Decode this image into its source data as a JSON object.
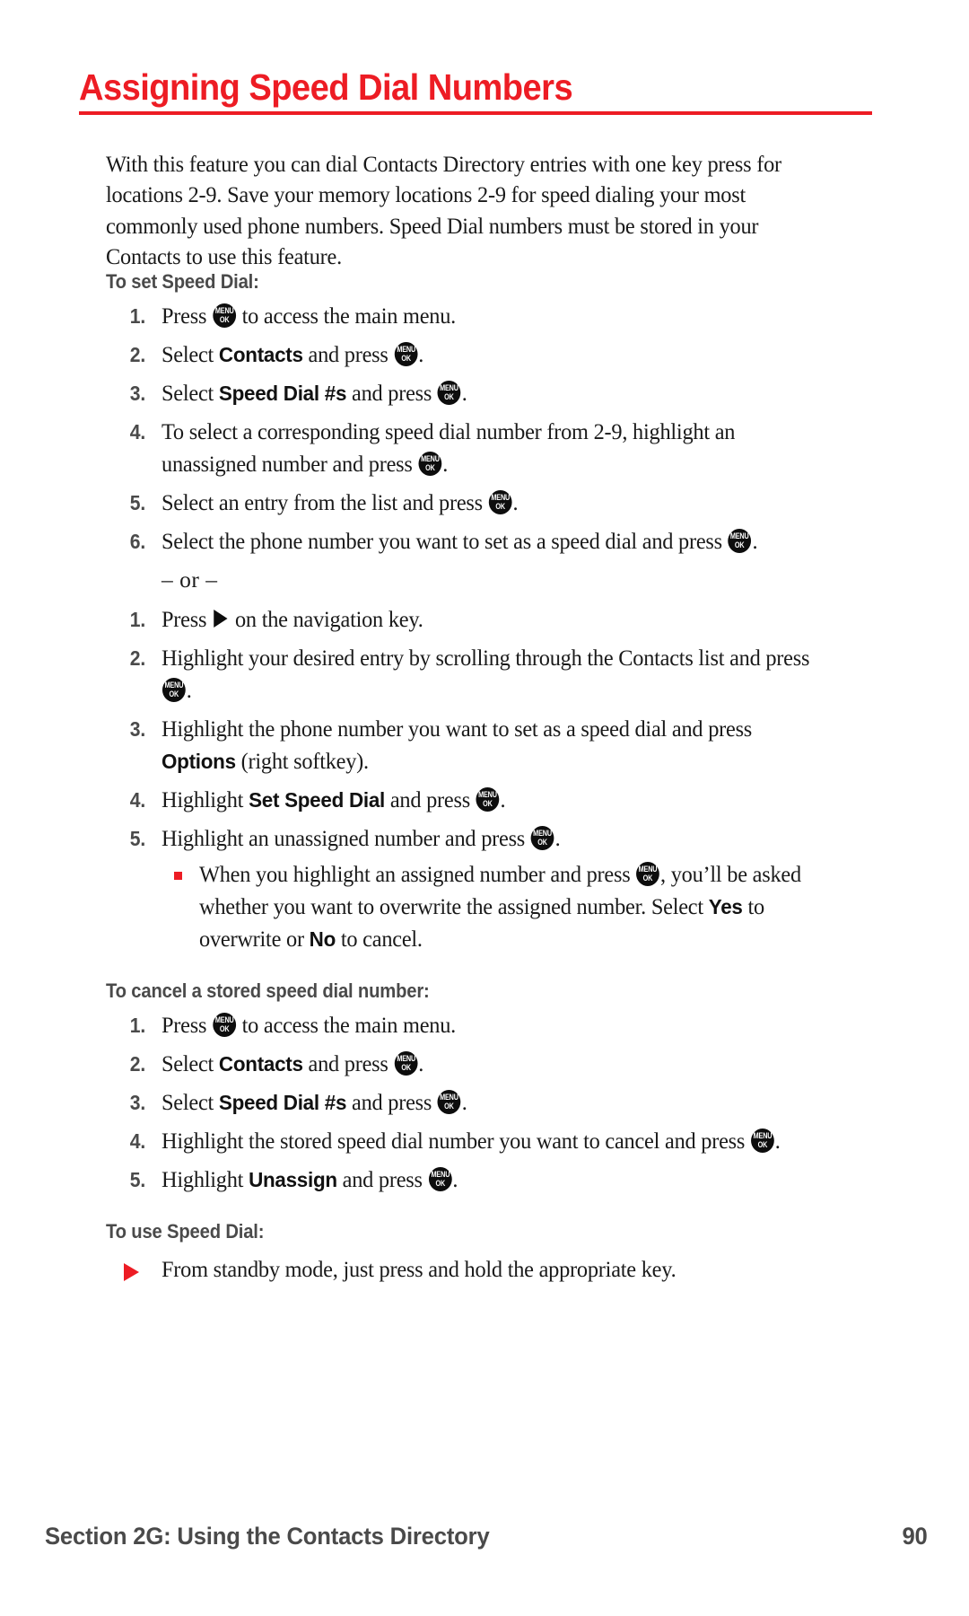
{
  "title": "Assigning Speed Dial Numbers",
  "accent_color": "#ED1C24",
  "heading_color": "#4a4a4a",
  "intro": "With this feature you can dial Contacts Directory entries with one key press for locations 2-9. Save your memory locations 2-9 for speed dialing your most commonly used phone numbers. Speed Dial numbers must be stored in your Contacts to use this feature.",
  "sections": {
    "set": {
      "heading": "To set Speed Dial:",
      "steps": [
        {
          "num": "1.",
          "pre": "Press ",
          "icon": "menu-ok-key",
          "post": " to access the main menu."
        },
        {
          "num": "2.",
          "pre": "Select ",
          "bold": "Contacts",
          "mid": " and press ",
          "icon": "menu-ok-key",
          "post": "."
        },
        {
          "num": "3.",
          "pre": "Select ",
          "bold": "Speed Dial #s",
          "mid": " and press ",
          "icon": "menu-ok-key",
          "post": "."
        },
        {
          "num": "4.",
          "pre": "To select a corresponding speed dial number from 2-9, highlight an unassigned number and press ",
          "icon": "menu-ok-key",
          "post": "."
        },
        {
          "num": "5.",
          "pre": "Select an entry from the list and press ",
          "icon": "menu-ok-key",
          "post": "."
        },
        {
          "num": "6.",
          "pre": "Select the phone number you want to set as a speed dial and press ",
          "icon": "menu-ok-key",
          "post": "."
        }
      ],
      "or_label": "– or –",
      "alt_steps": [
        {
          "num": "1.",
          "pre": "Press ",
          "icon": "nav-right-arrow",
          "post": " on the navigation key."
        },
        {
          "num": "2.",
          "pre": "Highlight your desired entry by scrolling through the Contacts list and press ",
          "icon": "menu-ok-key",
          "post": "."
        },
        {
          "num": "3.",
          "pre": "Highlight the phone number you want to set as a speed dial and press ",
          "bold": "Options",
          "mid": " (right softkey).",
          "icon": null,
          "post": ""
        },
        {
          "num": "4.",
          "pre": "Highlight ",
          "bold": "Set Speed Dial",
          "mid": " and press ",
          "icon": "menu-ok-key",
          "post": "."
        },
        {
          "num": "5.",
          "pre": "Highlight an unassigned number and press ",
          "icon": "menu-ok-key",
          "post": "."
        }
      ],
      "note": {
        "bullet": "red-square-bullet",
        "pre": "When you highlight an assigned number and press ",
        "icon": "menu-ok-key",
        "mid": ", you’ll be asked whether you want to overwrite the assigned number. Select ",
        "bold1": "Yes",
        "mid2": " to overwrite or ",
        "bold2": "No",
        "post": " to cancel."
      }
    },
    "cancel": {
      "heading": "To cancel a stored speed dial number:",
      "steps": [
        {
          "num": "1.",
          "pre": "Press ",
          "icon": "menu-ok-key",
          "post": " to access the main menu."
        },
        {
          "num": "2.",
          "pre": "Select ",
          "bold": "Contacts",
          "mid": " and press ",
          "icon": "menu-ok-key",
          "post": "."
        },
        {
          "num": "3.",
          "pre": "Select ",
          "bold": "Speed Dial #s",
          "mid": " and press ",
          "icon": "menu-ok-key",
          "post": "."
        },
        {
          "num": "4.",
          "pre": "Highlight the stored speed dial number you want to cancel and press ",
          "icon": "menu-ok-key",
          "post": "."
        },
        {
          "num": "5.",
          "pre": "Highlight ",
          "bold": "Unassign",
          "mid": " and press ",
          "icon": "menu-ok-key",
          "post": "."
        }
      ]
    },
    "use": {
      "heading": "To use Speed Dial:",
      "bullet": "red-triangle-bullet",
      "text": "From standby mode, just press and hold the appropriate key."
    }
  },
  "icons": {
    "menu_ok_line1": "MENU",
    "menu_ok_line2": "OK"
  },
  "footer": {
    "section_label": "Section 2G: Using the Contacts Directory",
    "page_number": "90"
  }
}
